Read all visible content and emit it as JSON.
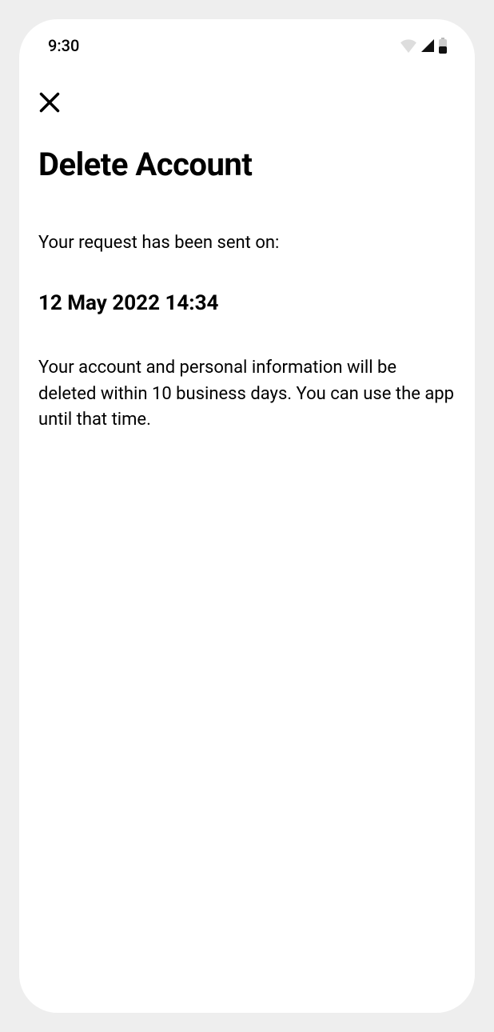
{
  "status_bar": {
    "time": "9:30"
  },
  "page": {
    "title": "Delete Account",
    "intro": "Your request has been sent on:",
    "date": "12 May 2022 14:34",
    "body": "Your account and personal information will be deleted within 10 business days. You can use the app until that time."
  }
}
